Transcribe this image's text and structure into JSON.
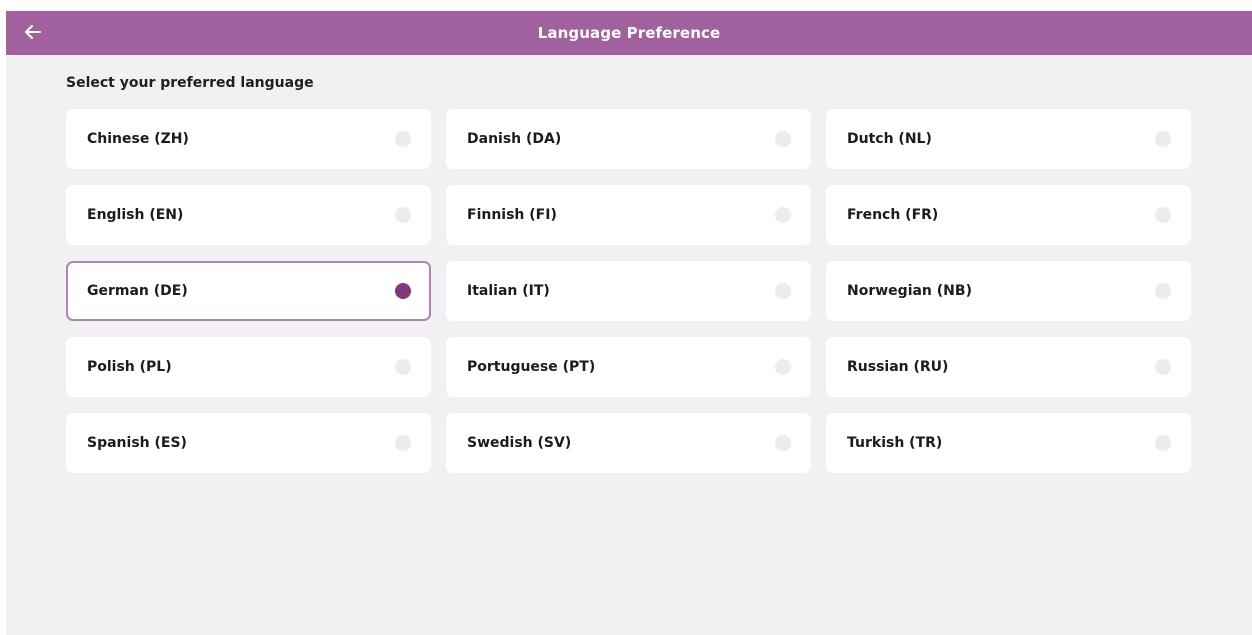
{
  "header": {
    "title": "Language Preference",
    "back_icon": "arrow-left-icon",
    "color": "#a0619e"
  },
  "prompt": "Select your preferred language",
  "languages": [
    {
      "label": "Chinese (ZH)",
      "selected": false
    },
    {
      "label": "Danish (DA)",
      "selected": false
    },
    {
      "label": "Dutch (NL)",
      "selected": false
    },
    {
      "label": "English (EN)",
      "selected": false
    },
    {
      "label": "Finnish (FI)",
      "selected": false
    },
    {
      "label": "French (FR)",
      "selected": false
    },
    {
      "label": "German (DE)",
      "selected": true
    },
    {
      "label": "Italian (IT)",
      "selected": false
    },
    {
      "label": "Norwegian (NB)",
      "selected": false
    },
    {
      "label": "Polish (PL)",
      "selected": false
    },
    {
      "label": "Portuguese (PT)",
      "selected": false
    },
    {
      "label": "Russian (RU)",
      "selected": false
    },
    {
      "label": "Spanish (ES)",
      "selected": false
    },
    {
      "label": "Swedish (SV)",
      "selected": false
    },
    {
      "label": "Turkish (TR)",
      "selected": false
    }
  ],
  "colors": {
    "selected_radio": "#7e3a7d",
    "selected_border": "#b184b1",
    "unselected_radio": "#ececee",
    "background": "#f1f1f4"
  }
}
